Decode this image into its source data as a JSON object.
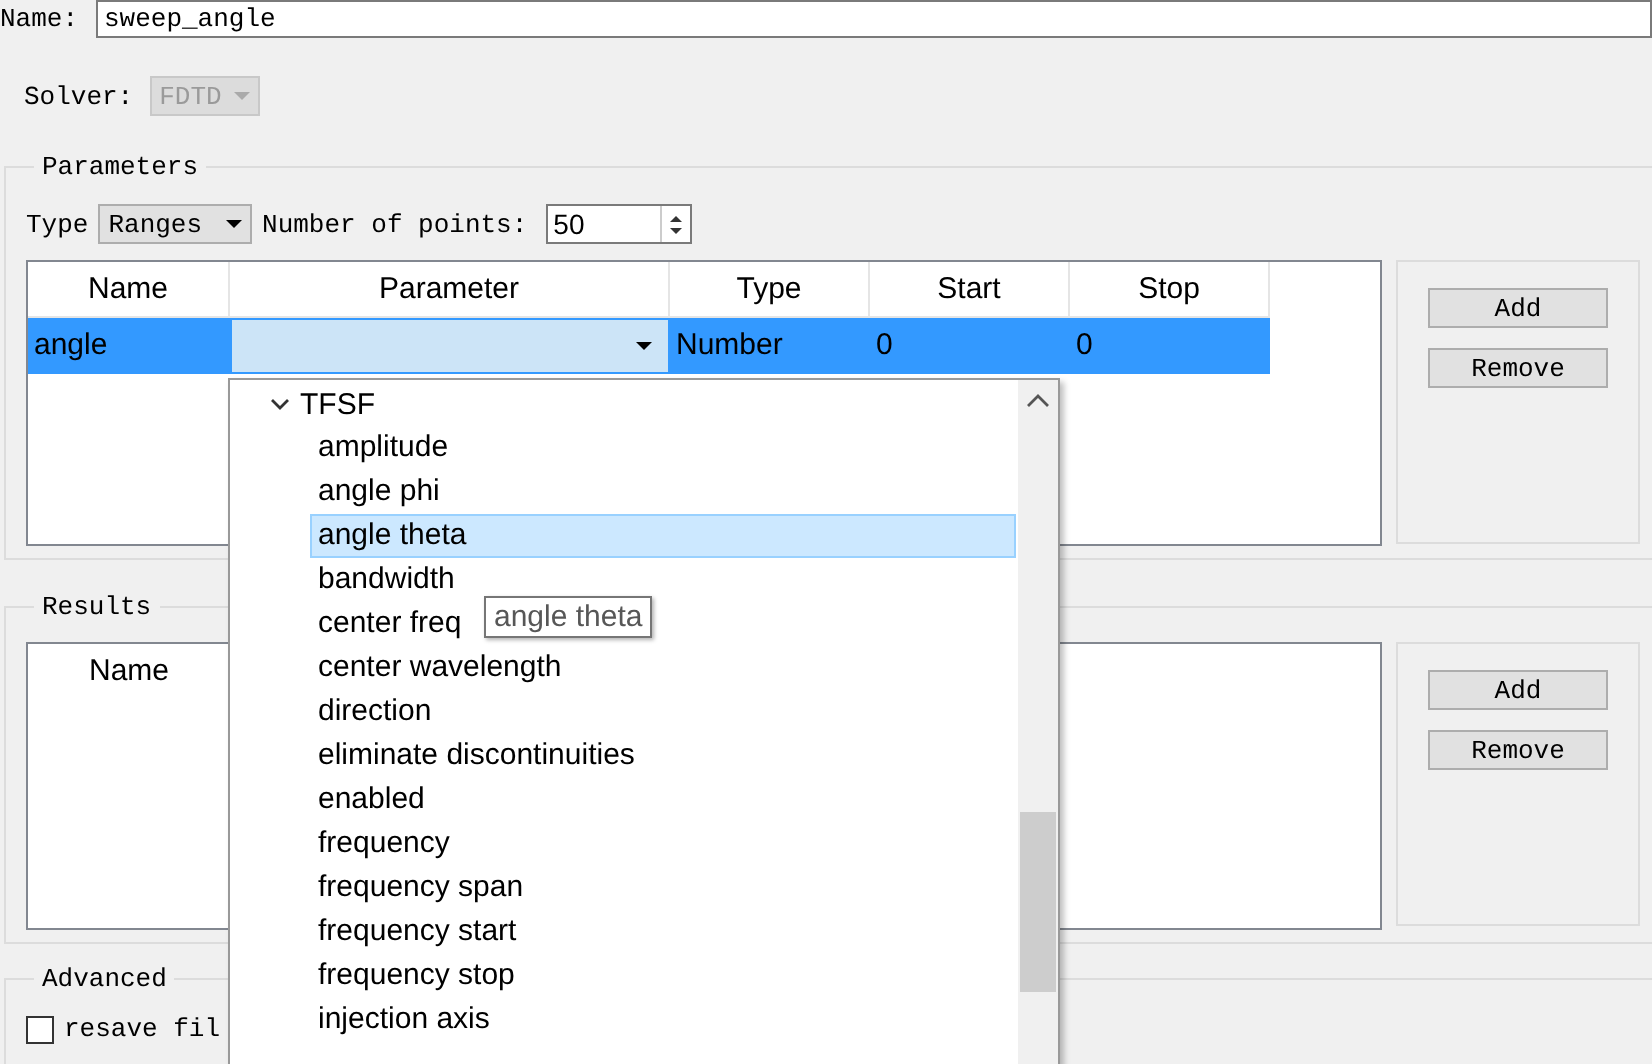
{
  "name_field": {
    "label": "Name:",
    "value": "sweep_angle"
  },
  "solver": {
    "label": "Solver:",
    "value": "FDTD",
    "disabled": true
  },
  "parameters": {
    "title": "Parameters",
    "type_label": "Type",
    "type_value": "Ranges",
    "points_label": "Number of points:",
    "points_value": "50",
    "columns": [
      "Name",
      "Parameter",
      "Type",
      "Start",
      "Stop"
    ],
    "rows": [
      {
        "name": "angle",
        "type": "Number",
        "start": "0",
        "stop": "0",
        "selected": true
      }
    ],
    "buttons": [
      "Add",
      "Remove"
    ]
  },
  "parameter_dropdown": {
    "tree": [
      {
        "label": "TFSF",
        "expanded": true,
        "children": [
          {
            "label": "amplitude",
            "selected": false
          },
          {
            "label": "angle phi",
            "selected": false
          },
          {
            "label": "angle theta",
            "selected": true
          },
          {
            "label": "bandwidth",
            "selected": false
          },
          {
            "label": "center freq",
            "selected": false
          },
          {
            "label": "center wavelength",
            "selected": false
          },
          {
            "label": "direction",
            "selected": false
          },
          {
            "label": "eliminate discontinuities",
            "selected": false
          },
          {
            "label": "enabled",
            "selected": false
          },
          {
            "label": "frequency",
            "selected": false
          },
          {
            "label": "frequency span",
            "selected": false
          },
          {
            "label": "frequency start",
            "selected": false
          },
          {
            "label": "frequency stop",
            "selected": false
          },
          {
            "label": "injection axis",
            "selected": false
          }
        ]
      }
    ],
    "tooltip": "angle theta"
  },
  "results": {
    "title": "Results",
    "columns": [
      "Name"
    ],
    "buttons": [
      "Add",
      "Remove"
    ]
  },
  "advanced": {
    "title": "Advanced",
    "checkboxes": [
      {
        "label": "resave fil",
        "checked": false
      }
    ]
  }
}
